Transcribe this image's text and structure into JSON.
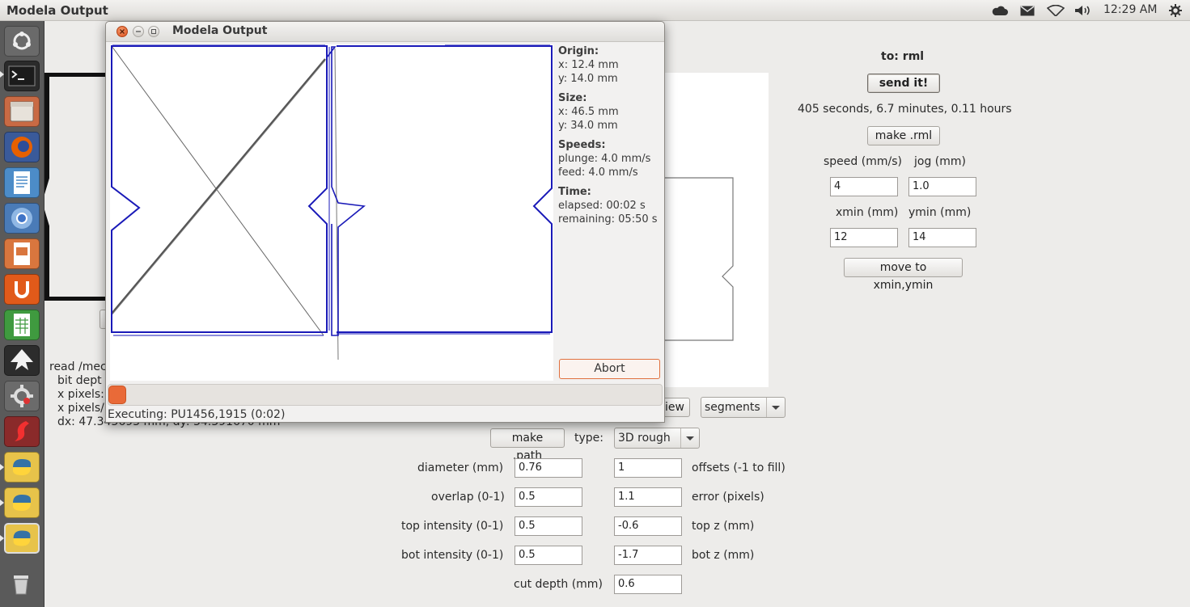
{
  "top_panel": {
    "app_title": "Modela Output",
    "clock": "12:29 AM",
    "icons": [
      "cloud-icon",
      "mail-icon",
      "wifi-icon",
      "volume-icon",
      "settings-gear-icon"
    ]
  },
  "launcher": {
    "items": [
      "dash-home",
      "terminal",
      "files",
      "firefox",
      "writer",
      "chromium",
      "impress",
      "ubuntu-one",
      "calc",
      "inkscape",
      "system-settings",
      "flash",
      "python",
      "python",
      "python",
      "trash"
    ]
  },
  "background_app": {
    "to_label": "to: rml",
    "send_button": "send it!",
    "time_estimate": "405 seconds, 6.7 minutes, 0.11 hours",
    "make_rml_button": "make .rml",
    "speed_label": "speed (mm/s)",
    "jog_label": "jog (mm)",
    "speed_value": "4",
    "jog_value": "1.0",
    "xmin_label": "xmin (mm)",
    "ymin_label": "ymin (mm)",
    "xmin_value": "12",
    "ymin_value": "14",
    "move_button": "move to xmin,ymin",
    "view_button": "iew",
    "view_select": "segments",
    "make_path_button": "make .path",
    "type_label": "type:",
    "type_select": "3D rough",
    "read_lines": [
      "read /mec",
      "bit dept",
      "x pixels:",
      "x pixels/",
      "dx: 47.343693 mm, dy: 34.391670 mm"
    ],
    "diameter_label": "diameter (mm)",
    "diameter_value": "0.76",
    "offsets_value": "1",
    "offsets_label": "offsets (-1 to fill)",
    "overlap_label": "overlap (0-1)",
    "overlap_value": "0.5",
    "error_value": "1.1",
    "error_label": "error (pixels)",
    "top_intensity_label": "top intensity (0-1)",
    "top_intensity_value": "0.5",
    "top_z_value": "-0.6",
    "top_z_label": "top z (mm)",
    "bot_intensity_label": "bot intensity (0-1)",
    "bot_intensity_value": "0.5",
    "bot_z_value": "-1.7",
    "bot_z_label": "bot z (mm)",
    "cut_depth_label": "cut depth (mm)",
    "cut_depth_value": "0.6"
  },
  "dialog": {
    "title": "Modela Output",
    "origin": {
      "heading": "Origin:",
      "x": "x: 12.4 mm",
      "y": "y: 14.0 mm"
    },
    "size": {
      "heading": "Size:",
      "x": "x: 46.5 mm",
      "y": "y: 34.0 mm"
    },
    "speeds": {
      "heading": "Speeds:",
      "plunge": "plunge: 4.0 mm/s",
      "feed": "feed: 4.0 mm/s"
    },
    "time": {
      "heading": "Time:",
      "elapsed": "elapsed: 00:02 s",
      "remaining": "remaining: 05:50 s"
    },
    "abort_button": "Abort",
    "progress": 0.02,
    "status": "Executing: PU1456,1915 (0:02)"
  },
  "colors": {
    "toolpath": "#1a1ab8",
    "travel": "#555555",
    "accent": "#e96a38",
    "launcher_bg": "#5a5a5a"
  }
}
